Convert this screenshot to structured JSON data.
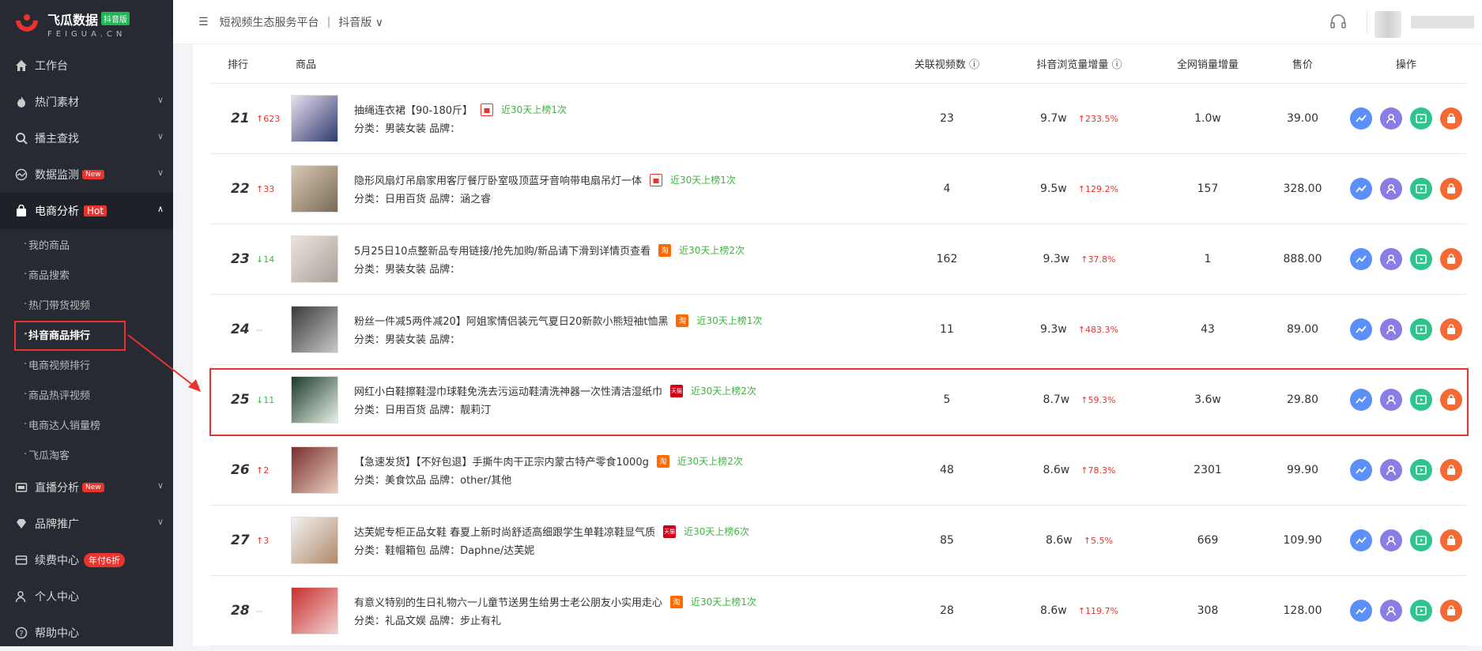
{
  "sidebar": {
    "logo_title": "飞瓜数据",
    "logo_badge": "抖音版",
    "logo_sub": "FEIGUA.CN",
    "items": [
      {
        "label": "工作台"
      },
      {
        "label": "热门素材"
      },
      {
        "label": "播主查找"
      },
      {
        "label": "数据监测",
        "badge": "New"
      },
      {
        "label": "电商分析",
        "badge": "Hot"
      }
    ],
    "sub_items": [
      {
        "label": "我的商品"
      },
      {
        "label": "商品搜索"
      },
      {
        "label": "热门带货视频"
      },
      {
        "label": "抖音商品排行"
      },
      {
        "label": "电商视频排行"
      },
      {
        "label": "商品热评视频"
      },
      {
        "label": "电商达人销量榜"
      },
      {
        "label": "飞瓜淘客"
      }
    ],
    "items_after": [
      {
        "label": "直播分析",
        "badge": "New"
      },
      {
        "label": "品牌推广"
      },
      {
        "label": "续费中心",
        "badge": "年付6折"
      },
      {
        "label": "个人中心"
      },
      {
        "label": "帮助中心"
      }
    ]
  },
  "topbar": {
    "platform": "短视频生态服务平台",
    "separator": "|",
    "version": "抖音版"
  },
  "table": {
    "headers": {
      "rank": "排行",
      "product": "商品",
      "videos": "关联视频数",
      "views": "抖音浏览量增量",
      "sales": "全网销量增量",
      "price": "售价",
      "ops": "操作"
    },
    "rows": [
      {
        "rank": "21",
        "change": "↑623",
        "dir": "up",
        "title": "抽绳连衣裙【90-180斤】",
        "shop": "dy",
        "tag": "近30天上榜1次",
        "category": "分类：男装女装 品牌：",
        "videos": "23",
        "views": "9.7w",
        "pct": "↑233.5%",
        "sales": "1.0w",
        "price": "39.00"
      },
      {
        "rank": "22",
        "change": "↑33",
        "dir": "up",
        "title": "隐形风扇灯吊扇家用客厅餐厅卧室吸顶蓝牙音响带电扇吊灯一体",
        "shop": "dy",
        "tag": "近30天上榜1次",
        "category": "分类：日用百货 品牌：涵之睿",
        "videos": "4",
        "views": "9.5w",
        "pct": "↑129.2%",
        "sales": "157",
        "price": "328.00"
      },
      {
        "rank": "23",
        "change": "↓14",
        "dir": "down",
        "title": "5月25日10点整新品专用链接/抢先加购/新品请下滑到详情页查看",
        "shop": "tb",
        "tag": "近30天上榜2次",
        "category": "分类：男装女装 品牌：",
        "videos": "162",
        "views": "9.3w",
        "pct": "↑37.8%",
        "sales": "1",
        "price": "888.00"
      },
      {
        "rank": "24",
        "change": "--",
        "dir": "flat",
        "title": "粉丝一件减5两件减20】阿姐家情侣装元气夏日20新款小熊短袖t恤黑",
        "shop": "tb",
        "tag": "近30天上榜1次",
        "category": "分类：男装女装 品牌：",
        "videos": "11",
        "views": "9.3w",
        "pct": "↑483.3%",
        "sales": "43",
        "price": "89.00"
      },
      {
        "rank": "25",
        "change": "↓11",
        "dir": "down",
        "title": "网红小白鞋擦鞋湿巾球鞋免洗去污运动鞋清洗神器一次性清洁湿纸巾",
        "shop": "tm",
        "tag": "近30天上榜2次",
        "category": "分类：日用百货 品牌：靓莉汀",
        "videos": "5",
        "views": "8.7w",
        "pct": "↑59.3%",
        "sales": "3.6w",
        "price": "29.80"
      },
      {
        "rank": "26",
        "change": "↑2",
        "dir": "up",
        "title": "【急速发货】【不好包退】手撕牛肉干正宗内蒙古特产零食1000g",
        "shop": "tb",
        "tag": "近30天上榜2次",
        "category": "分类：美食饮品 品牌：other/其他",
        "videos": "48",
        "views": "8.6w",
        "pct": "↑78.3%",
        "sales": "2301",
        "price": "99.90"
      },
      {
        "rank": "27",
        "change": "↑3",
        "dir": "up",
        "title": "达芙妮专柜正品女鞋 春夏上新时尚舒适高细跟学生单鞋凉鞋显气质",
        "shop": "tm",
        "tag": "近30天上榜6次",
        "category": "分类：鞋帽箱包 品牌：Daphne/达芙妮",
        "videos": "85",
        "views": "8.6w",
        "pct": "↑5.5%",
        "sales": "669",
        "price": "109.90"
      },
      {
        "rank": "28",
        "change": "--",
        "dir": "flat",
        "title": "有意义特别的生日礼物六一儿童节送男生给男士老公朋友小实用走心",
        "shop": "tb",
        "tag": "近30天上榜1次",
        "category": "分类：礼品文娱 品牌：步止有礼",
        "videos": "28",
        "views": "8.6w",
        "pct": "↑119.7%",
        "sales": "308",
        "price": "128.00"
      }
    ]
  },
  "colors": {
    "sidebar_bg": "#272a33",
    "accent_red": "#e8342d",
    "green": "#3fb342"
  }
}
